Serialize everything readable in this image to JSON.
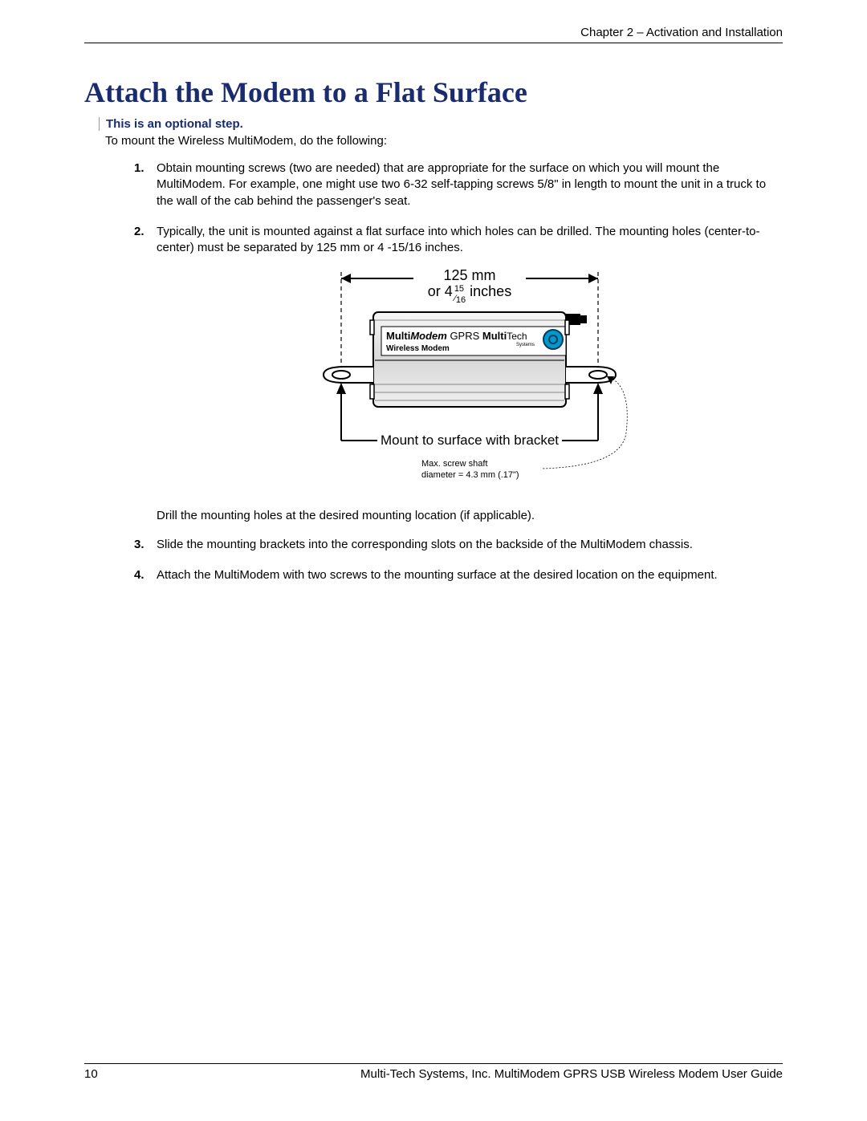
{
  "header": {
    "chapter": "Chapter 2 – Activation and Installation"
  },
  "title": "Attach the Modem to a Flat Surface",
  "optional_note": "This is an optional step.",
  "intro": "To mount the Wireless MultiModem, do the following:",
  "steps": [
    {
      "num": "1.",
      "text": "Obtain mounting screws (two are needed) that are appropriate for the surface on which you will mount the MultiModem. For example, one might use two 6-32 self-tapping screws 5/8\" in length to mount the unit in a truck to the wall of the cab behind the passenger's seat."
    },
    {
      "num": "2.",
      "text": "Typically, the unit is mounted against a flat surface into which holes can be drilled.  The mounting holes (center-to-center) must be separated by 125 mm or 4 -15/16 inches."
    },
    {
      "num": "3.",
      "text": "Slide the mounting brackets into the corresponding slots on the backside of the MultiModem chassis."
    },
    {
      "num": "4.",
      "text": "Attach the MultiModem with two screws to the mounting surface at the desired location on the equipment."
    }
  ],
  "diagram": {
    "dim_top_line1": "125 mm",
    "dim_top_line2_pre": "or 4",
    "dim_top_frac_num": "15",
    "dim_top_frac_den": "16",
    "dim_top_line2_post": " inches",
    "device_label_prefix": "Multi",
    "device_label_modem": "Modem",
    "device_label_gprs": " GPRS ",
    "device_label_multi2": "Multi",
    "device_label_tech": "Tech",
    "device_label_systems": "Systems",
    "device_sublabel": "Wireless Modem",
    "bracket_label": "Mount to surface with bracket",
    "screw_note_l1": "Max. screw shaft",
    "screw_note_l2": "diameter = 4.3 mm (.17\")"
  },
  "post_diagram": "Drill the mounting holes at the desired mounting location (if applicable).",
  "footer": {
    "page_num": "10",
    "guide": "Multi-Tech Systems, Inc. MultiModem GPRS USB Wireless Modem User Guide"
  }
}
